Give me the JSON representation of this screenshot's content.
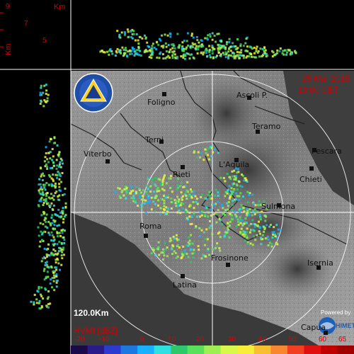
{
  "colors": {
    "background": "#000000",
    "red": "#d40000",
    "range_ring": "#ffffff",
    "border": "#222222"
  },
  "header": {
    "date": "25 Mar 2015",
    "time": "13:00 CET"
  },
  "side_axis": {
    "km_label": "Km",
    "ticks": [
      "9",
      "7",
      "5"
    ],
    "left_km_label": "Km"
  },
  "range_label": "120.0Km",
  "product_label": "HVMI [dBZ]",
  "powered_by": "Powered by",
  "himet_logo": "HIMET",
  "logo_icon": "protezione-civile-logo",
  "color_scale": {
    "labels": [
      "-20",
      "-10",
      "0",
      "10",
      "20",
      "30",
      "40",
      "50",
      "60",
      "65"
    ],
    "colors": [
      "#1a0a4a",
      "#2a1a8a",
      "#2c3ad0",
      "#1c78e0",
      "#18b0ff",
      "#2ee0e0",
      "#2ec86a",
      "#58e05a",
      "#9ef052",
      "#d8f84a",
      "#f8ee3a",
      "#f8c030",
      "#f88830",
      "#f04020",
      "#e01010",
      "#c00000",
      "#a00000"
    ]
  },
  "cities": [
    {
      "name": "Foligno"
    },
    {
      "name": "Ascoli P."
    },
    {
      "name": "Teramo"
    },
    {
      "name": "Terni"
    },
    {
      "name": "Viterbo"
    },
    {
      "name": "Pescara"
    },
    {
      "name": "L'Aquila"
    },
    {
      "name": "Rieti"
    },
    {
      "name": "Chieti"
    },
    {
      "name": "Sulmona"
    },
    {
      "name": "Roma"
    },
    {
      "name": "Frosinone"
    },
    {
      "name": "Isernia"
    },
    {
      "name": "Latina"
    },
    {
      "name": "Capua"
    }
  ]
}
